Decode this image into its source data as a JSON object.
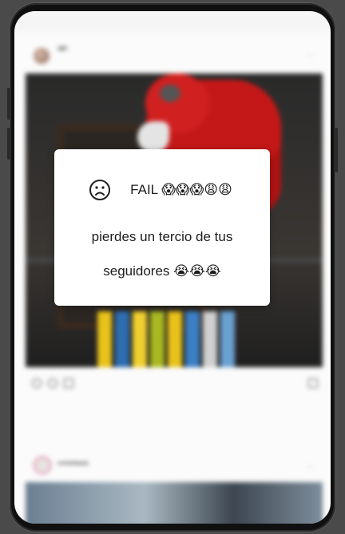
{
  "status_bar": {
    "time": ""
  },
  "feed": {
    "post1": {
      "username": "ajjjd",
      "subtitle": "",
      "likes_text": "",
      "caption": "",
      "time": ""
    },
    "post2": {
      "username": "srxwwdaaaaa"
    }
  },
  "dialog": {
    "headline": "FAIL 😱😱😱😩😩",
    "line2": "pierdes un tercio de tus",
    "line3": "seguidores 😭😭😭",
    "icon": "sad-face-icon"
  },
  "colors": {
    "accent_red": "#c41818",
    "dialog_bg": "#ffffff",
    "backdrop": "#4a4a4a"
  }
}
